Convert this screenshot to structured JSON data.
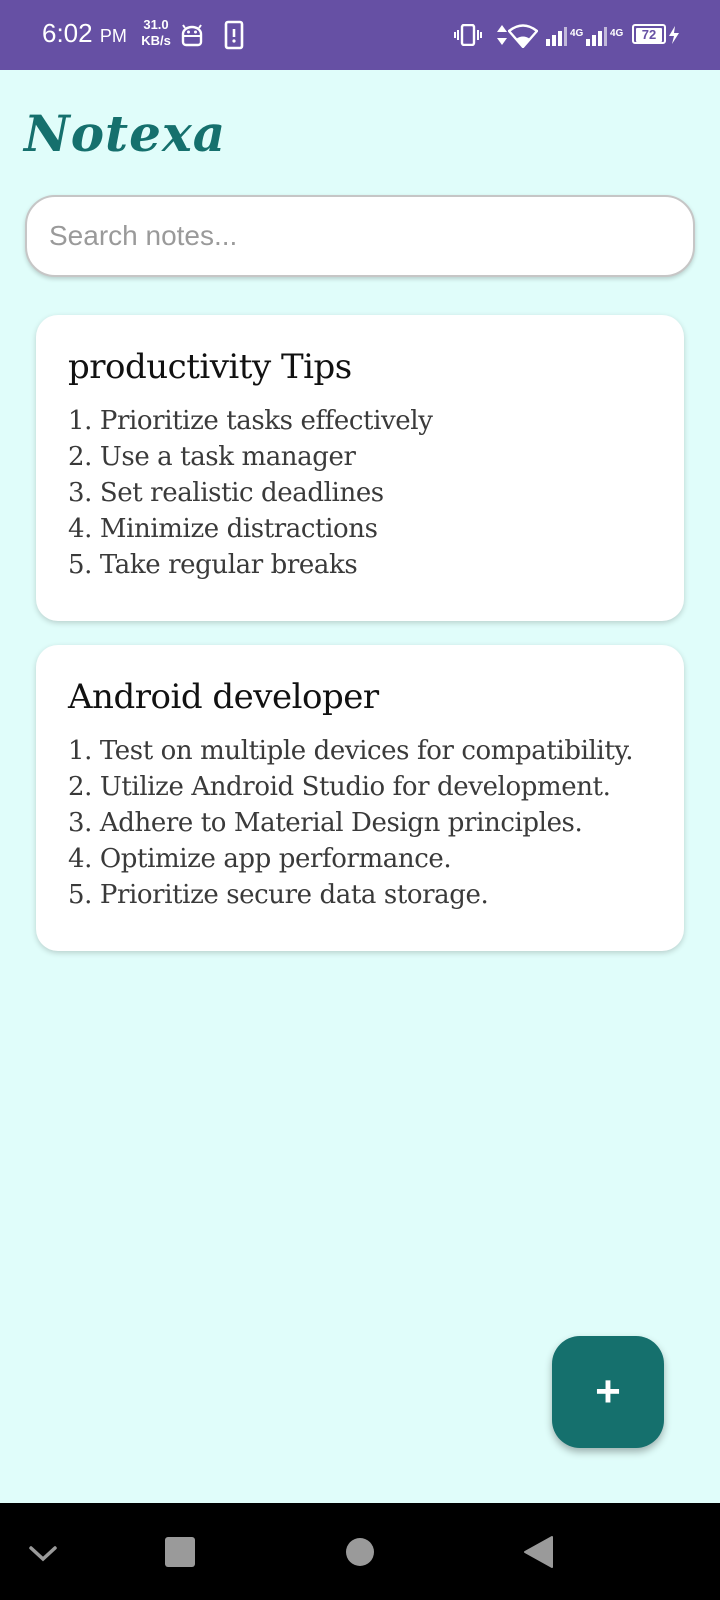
{
  "status_bar": {
    "time": "6:02",
    "ampm": "PM",
    "net_speed_value": "31.0",
    "net_speed_unit": "KB/s",
    "network_label_1": "4G",
    "network_label_2": "4G",
    "battery": "72",
    "icons": [
      "android-icon",
      "alert-phone-icon",
      "vibrate-icon",
      "data-arrows-icon",
      "wifi-icon",
      "signal-icon",
      "signal-icon",
      "battery-icon",
      "charging-icon"
    ]
  },
  "app": {
    "title": "Notexa",
    "accent_color": "#15706d",
    "background_color": "#e0fdfa",
    "status_bar_color": "#6650a4"
  },
  "search": {
    "placeholder": "Search notes..."
  },
  "notes": [
    {
      "title": "productivity Tips",
      "lines": [
        "1. Prioritize tasks effectively",
        "2. Use a task manager",
        "3. Set realistic deadlines",
        "4. Minimize distractions",
        "5. Take regular breaks"
      ]
    },
    {
      "title": "Android developer",
      "lines": [
        "1. Test on multiple devices for compatibility.",
        "2. Utilize Android Studio for development.",
        "3. Adhere to Material Design principles.",
        "4. Optimize app performance.",
        "5. Prioritize secure data storage."
      ]
    }
  ],
  "fab": {
    "label": "+"
  },
  "nav_bar": {
    "buttons": [
      "chevron-down-icon",
      "recents-icon",
      "home-icon",
      "back-icon"
    ]
  }
}
